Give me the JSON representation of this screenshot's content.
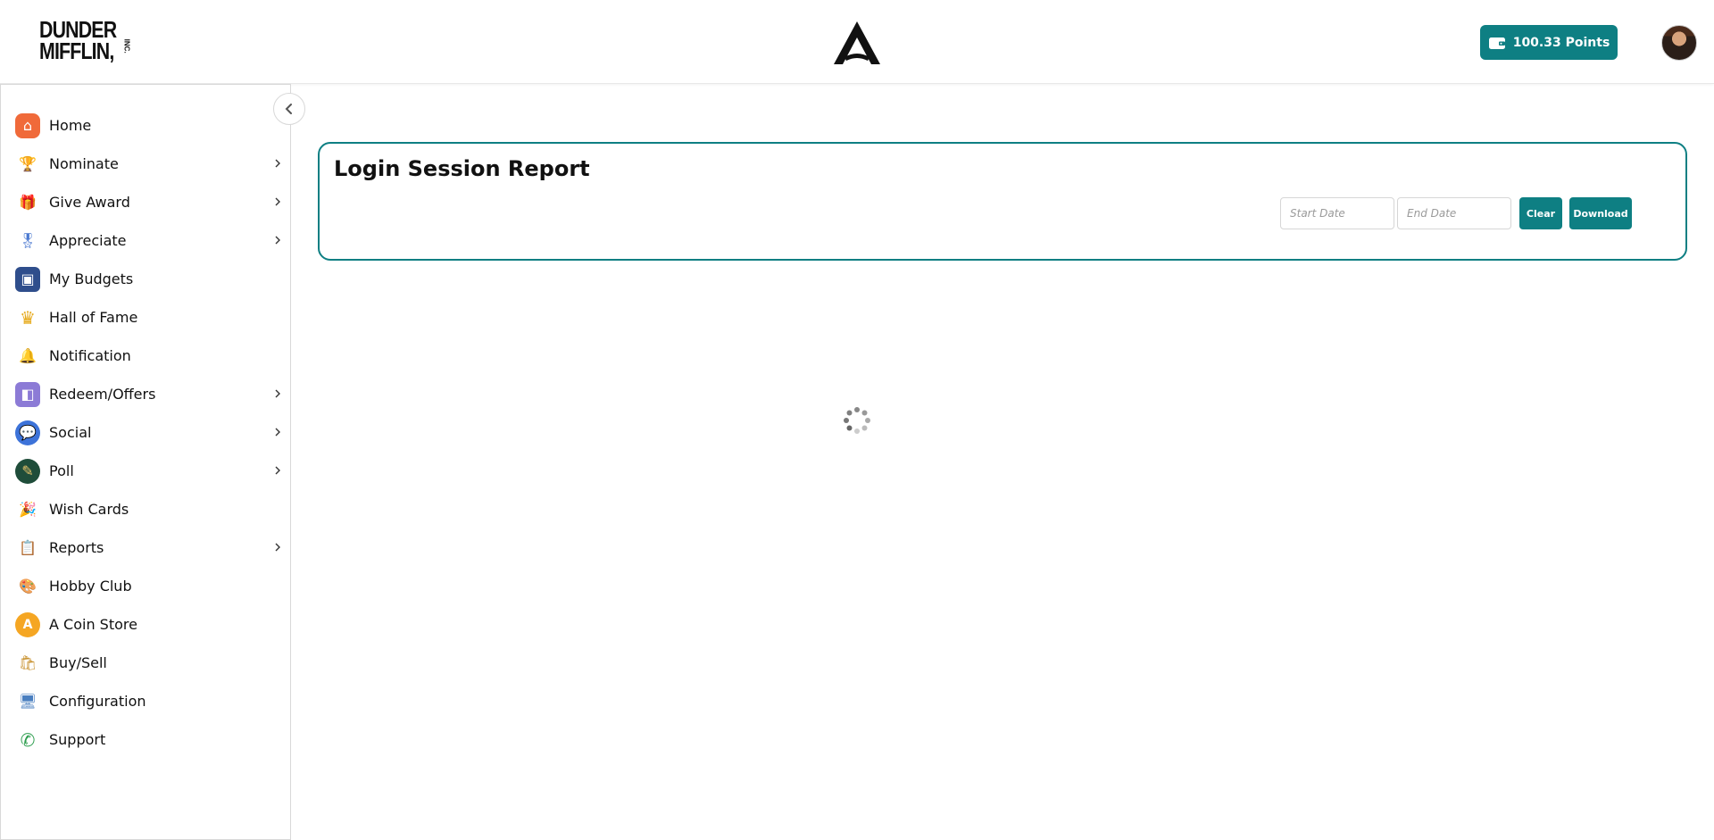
{
  "header": {
    "logo_line1": "DUNDER",
    "logo_line2": "MIFFLIN,",
    "logo_suffix": "INC.",
    "points_label": "100.33 Points",
    "brand_mark_icon": "a-logo-icon",
    "wallet_icon": "wallet-icon",
    "avatar_icon": "user-avatar"
  },
  "sidebar": {
    "collapse_icon": "chevron-left-icon",
    "items": [
      {
        "label": "Home",
        "icon": "home-icon",
        "has_submenu": false
      },
      {
        "label": "Nominate",
        "icon": "trophy-icon",
        "has_submenu": true
      },
      {
        "label": "Give Award",
        "icon": "gift-icon",
        "has_submenu": true
      },
      {
        "label": "Appreciate",
        "icon": "ribbon-icon",
        "has_submenu": true
      },
      {
        "label": "My Budgets",
        "icon": "wallet-icon",
        "has_submenu": false
      },
      {
        "label": "Hall of Fame",
        "icon": "crown-icon",
        "has_submenu": false
      },
      {
        "label": "Notification",
        "icon": "bell-icon",
        "has_submenu": false
      },
      {
        "label": "Redeem/Offers",
        "icon": "purse-icon",
        "has_submenu": true
      },
      {
        "label": "Social",
        "icon": "chat-icon",
        "has_submenu": true
      },
      {
        "label": "Poll",
        "icon": "poll-icon",
        "has_submenu": true
      },
      {
        "label": "Wish Cards",
        "icon": "party-popper-icon",
        "has_submenu": false
      },
      {
        "label": "Reports",
        "icon": "clipboard-icon",
        "has_submenu": true
      },
      {
        "label": "Hobby Club",
        "icon": "palette-icon",
        "has_submenu": false
      },
      {
        "label": "A Coin Store",
        "icon": "coin-icon",
        "has_submenu": false
      },
      {
        "label": "Buy/Sell",
        "icon": "shopping-bags-icon",
        "has_submenu": false
      },
      {
        "label": "Configuration",
        "icon": "monitor-icon",
        "has_submenu": false
      },
      {
        "label": "Support",
        "icon": "phone-icon",
        "has_submenu": false
      }
    ]
  },
  "report": {
    "title": "Login Session Report",
    "start_date_placeholder": "Start Date",
    "start_date_value": "",
    "end_date_placeholder": "End Date",
    "end_date_value": "",
    "clear_label": "Clear",
    "download_label": "Download"
  },
  "status": {
    "loading_icon": "loading-spinner-icon"
  },
  "colors": {
    "accent": "#0e7f83"
  }
}
